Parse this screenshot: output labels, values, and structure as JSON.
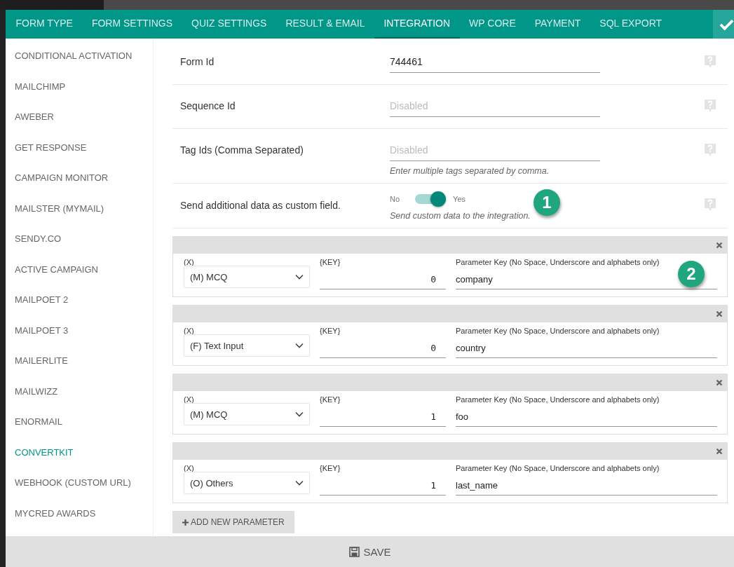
{
  "tabs": [
    {
      "label": "FORM TYPE",
      "selected": false
    },
    {
      "label": "FORM SETTINGS",
      "selected": false
    },
    {
      "label": "QUIZ SETTINGS",
      "selected": false
    },
    {
      "label": "RESULT & EMAIL",
      "selected": false
    },
    {
      "label": "INTEGRATION",
      "selected": true
    },
    {
      "label": "WP CORE",
      "selected": false
    },
    {
      "label": "PAYMENT",
      "selected": false
    },
    {
      "label": "SQL EXPORT",
      "selected": false
    }
  ],
  "sidebar": {
    "items": [
      {
        "label": "CONDITIONAL ACTIVATION",
        "selected": false
      },
      {
        "label": "MAILCHIMP",
        "selected": false
      },
      {
        "label": "AWEBER",
        "selected": false
      },
      {
        "label": "GET RESPONSE",
        "selected": false
      },
      {
        "label": "CAMPAIGN MONITOR",
        "selected": false
      },
      {
        "label": "MAILSTER (MYMAIL)",
        "selected": false
      },
      {
        "label": "SENDY.CO",
        "selected": false
      },
      {
        "label": "ACTIVE CAMPAIGN",
        "selected": false
      },
      {
        "label": "MAILPOET 2",
        "selected": false
      },
      {
        "label": "MAILPOET 3",
        "selected": false
      },
      {
        "label": "MAILERLITE",
        "selected": false
      },
      {
        "label": "MAILWIZZ",
        "selected": false
      },
      {
        "label": "ENORMAIL",
        "selected": false
      },
      {
        "label": "CONVERTKIT",
        "selected": true
      },
      {
        "label": "WEBHOOK (CUSTOM URL)",
        "selected": false
      },
      {
        "label": "MYCRED AWARDS",
        "selected": false
      }
    ]
  },
  "settings": [
    {
      "kind": "text",
      "label": "Form Id",
      "value": "744461"
    },
    {
      "kind": "text",
      "label": "Sequence Id",
      "placeholder": "Disabled"
    },
    {
      "kind": "text",
      "label": "Tag Ids (Comma Separated)",
      "placeholder": "Disabled",
      "help": "Enter multiple tags separated by comma."
    },
    {
      "kind": "toggle",
      "label": "Send additional data as custom field.",
      "off_label": "No",
      "on_label": "Yes",
      "on": true,
      "help": "Send custom data to the integration.",
      "annotation": "1"
    }
  ],
  "parameters": [
    {
      "x_label": "(X)",
      "x_value": "(M) MCQ",
      "key_label": "{KEY}",
      "key_value": "0",
      "param_label": "Parameter Key (No Space, Underscore and alphabets only)",
      "param_value": "company",
      "annotation": "2"
    },
    {
      "x_label": "(X)",
      "x_value": "(F) Text Input",
      "key_label": "{KEY}",
      "key_value": "0",
      "param_label": "Parameter Key (No Space, Underscore and alphabets only)",
      "param_value": "country"
    },
    {
      "x_label": "(X)",
      "x_value": "(M) MCQ",
      "key_label": "{KEY}",
      "key_value": "1",
      "param_label": "Parameter Key (No Space, Underscore and alphabets only)",
      "param_value": "foo"
    },
    {
      "x_label": "(X)",
      "x_value": "(O) Others",
      "key_label": "{KEY}",
      "key_value": "1",
      "param_label": "Parameter Key (No Space, Underscore and alphabets only)",
      "param_value": "last_name"
    }
  ],
  "add_button": "ADD NEW PARAMETER",
  "save_button": "SAVE"
}
